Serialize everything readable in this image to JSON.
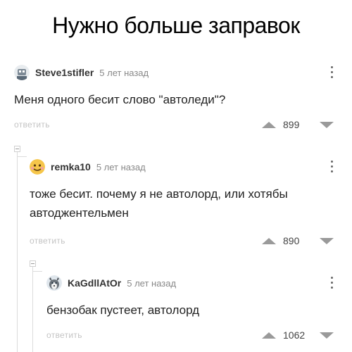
{
  "title": "Нужно больше заправок",
  "comments": [
    {
      "username": "Steve1stifler",
      "time": "5 лет назад",
      "text": "Меня одного бесит слово \"автоледи\"?",
      "reply_label": "ответить",
      "score": "899",
      "avatar_icon": "robot-avatar-icon"
    },
    {
      "username": "remka10",
      "time": "5 лет назад",
      "text": "тоже бесит. почему я не автолорд, или хотябы автоджентельмен",
      "reply_label": "ответить",
      "score": "890",
      "avatar_icon": "emoji-face-avatar-icon"
    },
    {
      "username": "KaGdllAtOr",
      "time": "5 лет назад",
      "text": "бензобак пустеет, автолорд",
      "reply_label": "ответить",
      "score": "1062",
      "avatar_icon": "husky-avatar-icon"
    }
  ],
  "colors": {
    "vote_arrow": "#9a9a9a",
    "reply": "#c4c4c4",
    "time": "#888888"
  }
}
